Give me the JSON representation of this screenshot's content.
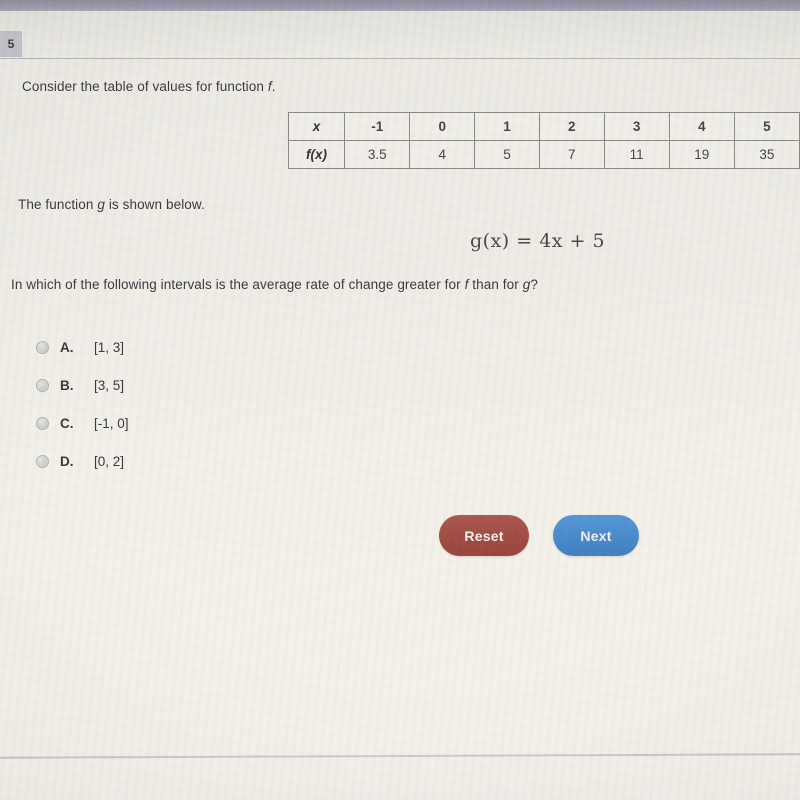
{
  "window": {
    "tab_number": "5"
  },
  "content": {
    "prompt_1_prefix": "Consider the table of values for function ",
    "prompt_1_italic": "f",
    "prompt_1_suffix": ".",
    "prompt_2_prefix": "The function ",
    "prompt_2_italic": "g",
    "prompt_2_suffix": " is shown below.",
    "equation": "g(x) = 4x + 5",
    "question_part_1": "In which of the following intervals is the average rate of change greater for ",
    "question_italic_1": "f",
    "question_part_2": " than for ",
    "question_italic_2": "g",
    "question_part_3": "?"
  },
  "table": {
    "row_labels": [
      "x",
      "f(x)"
    ],
    "x_values": [
      "-1",
      "0",
      "1",
      "2",
      "3",
      "4",
      "5"
    ],
    "fx_values": [
      "3.5",
      "4",
      "5",
      "7",
      "11",
      "19",
      "35"
    ]
  },
  "options": [
    {
      "letter": "A.",
      "text": "[1, 3]",
      "selected": false
    },
    {
      "letter": "B.",
      "text": "[3, 5]",
      "selected": false
    },
    {
      "letter": "C.",
      "text": "[-1, 0]",
      "selected": false
    },
    {
      "letter": "D.",
      "text": "[0, 2]",
      "selected": false
    }
  ],
  "buttons": {
    "reset_label": "Reset",
    "next_label": "Next"
  },
  "colors": {
    "reset_button": "#a14d43",
    "next_button": "#4a8bcd",
    "top_bar": "#9a9aac",
    "tab_badge": "#c2c2ca",
    "page_background": "#eceae4",
    "text": "#3c3c40"
  }
}
